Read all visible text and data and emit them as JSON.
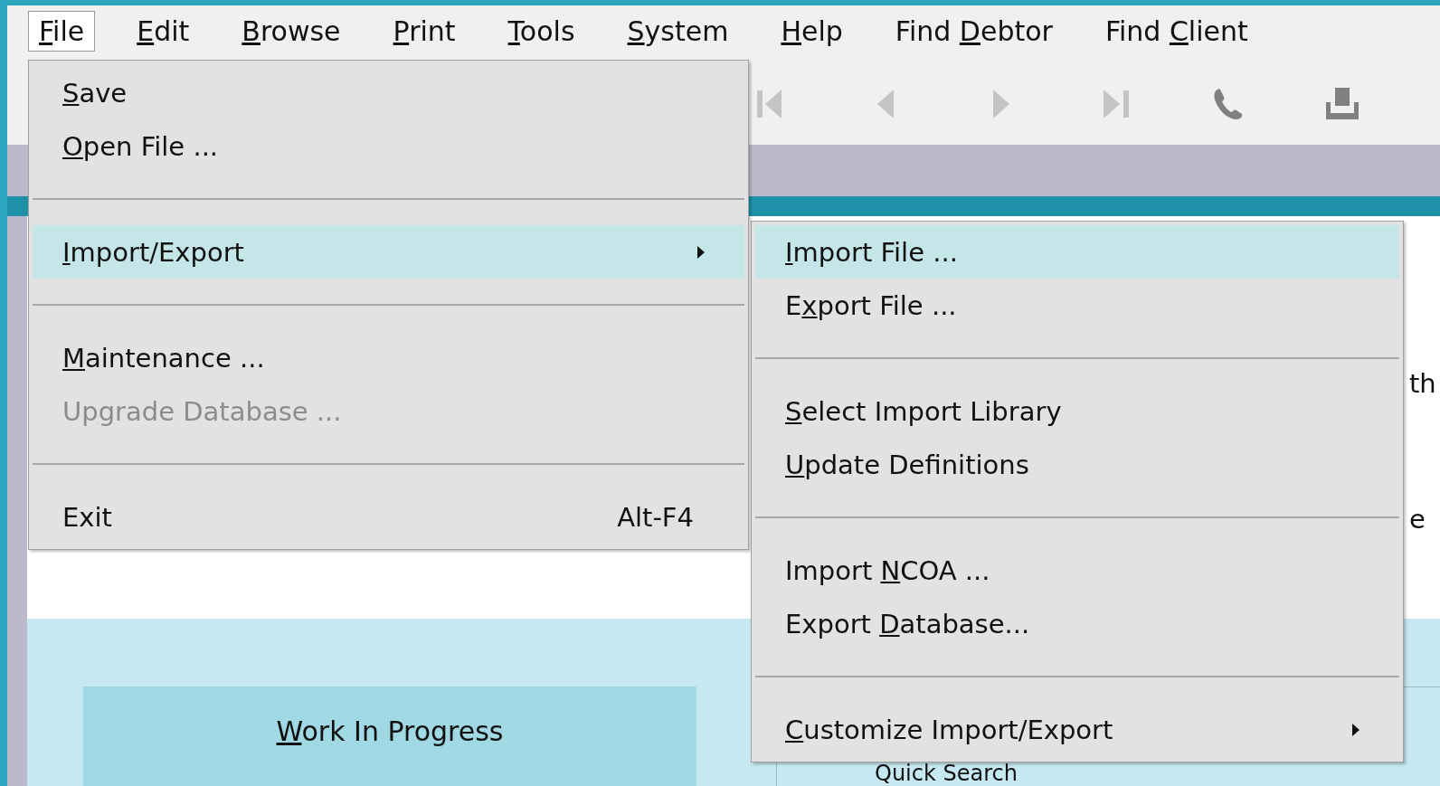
{
  "menubar": [
    {
      "label": {
        "key": "F",
        "after": "ile"
      },
      "selected": true
    },
    {
      "label": {
        "key": "E",
        "after": "dit"
      },
      "selected": false
    },
    {
      "label": {
        "key": "B",
        "after": "rowse"
      },
      "selected": false
    },
    {
      "label": {
        "key": "P",
        "after": "rint"
      },
      "selected": false
    },
    {
      "label": {
        "key": "T",
        "after": "ools"
      },
      "selected": false
    },
    {
      "label": {
        "key": "S",
        "after": "ystem"
      },
      "selected": false
    },
    {
      "label": {
        "key": "H",
        "after": "elp"
      },
      "selected": false
    },
    {
      "label": {
        "before": "Find ",
        "key": "D",
        "after": "ebtor"
      },
      "selected": false
    },
    {
      "label": {
        "before": "Find ",
        "key": "C",
        "after": "lient"
      },
      "selected": false
    }
  ],
  "toolbar": [
    {
      "kind": "first",
      "disabled": true
    },
    {
      "kind": "previous",
      "disabled": true
    },
    {
      "kind": "next",
      "disabled": true
    },
    {
      "kind": "last",
      "disabled": true
    },
    {
      "kind": "phone",
      "disabled": false
    },
    {
      "kind": "tray",
      "disabled": false
    }
  ],
  "file_menu": [
    {
      "kind": "item",
      "label": {
        "key": "S",
        "after": "ave"
      },
      "selected": false,
      "disabled": false,
      "submenu": false
    },
    {
      "kind": "item",
      "label": {
        "key": "O",
        "after": "pen File ..."
      },
      "selected": false,
      "disabled": false,
      "submenu": false
    },
    {
      "kind": "separator"
    },
    {
      "kind": "item",
      "label": {
        "key": "I",
        "after": "mport/Export"
      },
      "selected": true,
      "disabled": false,
      "submenu": true
    },
    {
      "kind": "separator"
    },
    {
      "kind": "item",
      "label": {
        "key": "M",
        "after": "aintenance ..."
      },
      "selected": false,
      "disabled": false,
      "submenu": false
    },
    {
      "kind": "item",
      "label": {
        "before": "Up",
        "key": "g",
        "after": "rade Database ..."
      },
      "selected": false,
      "disabled": true,
      "submenu": false
    },
    {
      "kind": "separator"
    },
    {
      "kind": "item",
      "label": {
        "after": "Exit"
      },
      "shortcut": "Alt-F4",
      "selected": false,
      "disabled": false,
      "submenu": false
    }
  ],
  "import_export_menu": [
    {
      "kind": "item",
      "label": {
        "key": "I",
        "after": "mport File ..."
      },
      "selected": true,
      "disabled": false,
      "submenu": false
    },
    {
      "kind": "item",
      "label": {
        "before": "E",
        "key": "x",
        "after": "port File ..."
      },
      "selected": false,
      "disabled": false,
      "submenu": false
    },
    {
      "kind": "separator"
    },
    {
      "kind": "item",
      "label": {
        "key": "S",
        "after": "elect Import Library"
      },
      "selected": false,
      "disabled": false,
      "submenu": false
    },
    {
      "kind": "item",
      "label": {
        "key": "U",
        "after": "pdate Definitions"
      },
      "selected": false,
      "disabled": false,
      "submenu": false
    },
    {
      "kind": "separator"
    },
    {
      "kind": "item",
      "label": {
        "before": "Import ",
        "key": "N",
        "after": "COA ..."
      },
      "selected": false,
      "disabled": false,
      "submenu": false
    },
    {
      "kind": "item",
      "label": {
        "before": "Export ",
        "key": "D",
        "after": "atabase..."
      },
      "selected": false,
      "disabled": false,
      "submenu": false
    },
    {
      "kind": "separator"
    },
    {
      "kind": "item",
      "label": {
        "key": "C",
        "after": "ustomize Import/Export"
      },
      "selected": false,
      "disabled": false,
      "submenu": true
    }
  ],
  "content": {
    "fragments": [
      "th",
      "e"
    ]
  },
  "work_button": {
    "label": {
      "key": "W",
      "after": "ork In Progress"
    }
  },
  "quick_search": {
    "label": "Quick Search"
  }
}
